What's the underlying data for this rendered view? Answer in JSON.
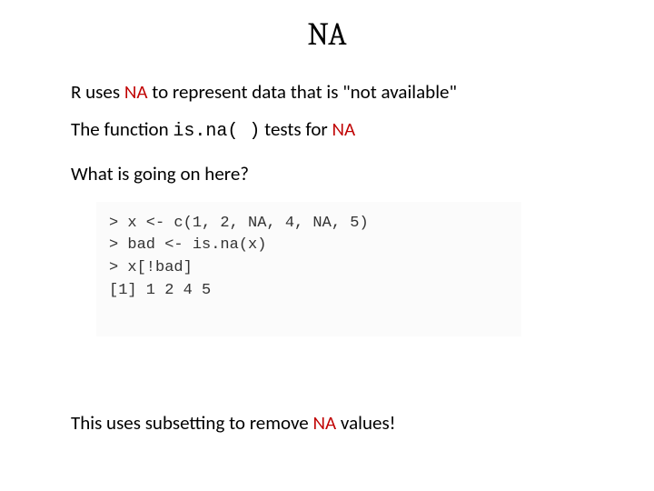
{
  "title": "NA",
  "line1": {
    "pre": "R uses ",
    "na": "NA",
    "post": " to represent data that is \"not available\""
  },
  "line2": {
    "pre": "The function ",
    "code": "is.na( )",
    "mid": " tests for ",
    "na": "NA"
  },
  "line3": "What is going on here?",
  "code": {
    "l1": "> x <- c(1, 2, NA, 4, NA, 5)",
    "l2": "> bad <- is.na(x)",
    "l3": "> x[!bad]",
    "l4": "[1] 1 2 4 5"
  },
  "conclusion": {
    "pre": "This uses subsetting to remove ",
    "na": "NA",
    "post": " values!"
  }
}
